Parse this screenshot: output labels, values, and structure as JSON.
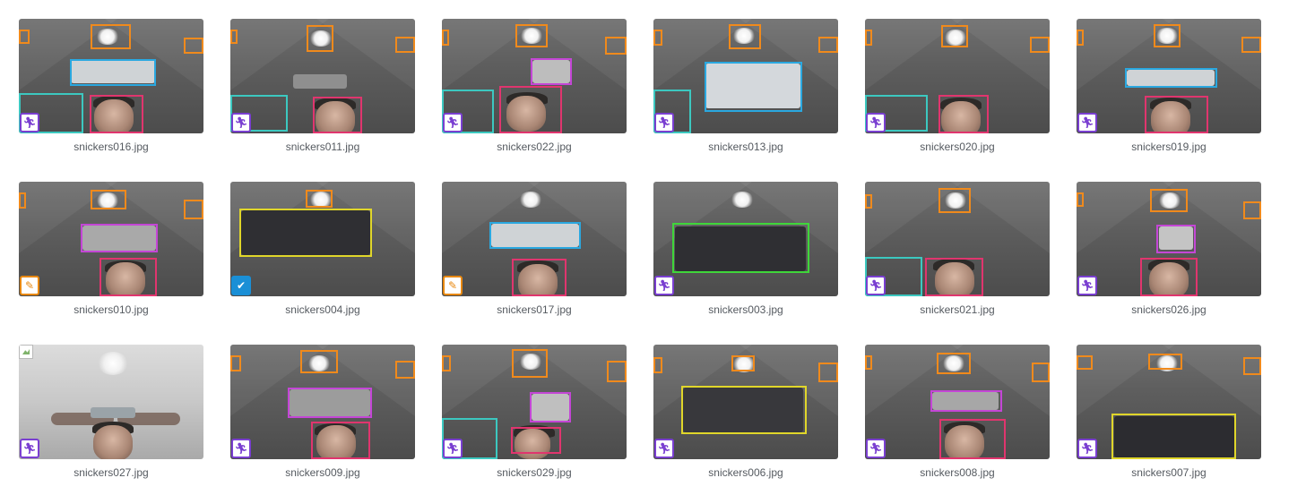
{
  "gallery": {
    "items": [
      {
        "filename": "snickers016.jpg",
        "badge_icon": "running-person-icon",
        "badge_color": "#7a3fd1"
      },
      {
        "filename": "snickers011.jpg",
        "badge_icon": "running-person-icon",
        "badge_color": "#7a3fd1"
      },
      {
        "filename": "snickers022.jpg",
        "badge_icon": "running-person-icon",
        "badge_color": "#7a3fd1"
      },
      {
        "filename": "snickers013.jpg",
        "badge_icon": "running-person-icon",
        "badge_color": "#7a3fd1"
      },
      {
        "filename": "snickers020.jpg",
        "badge_icon": "running-person-icon",
        "badge_color": "#7a3fd1"
      },
      {
        "filename": "snickers019.jpg",
        "badge_icon": "running-person-icon",
        "badge_color": "#7a3fd1"
      },
      {
        "filename": "snickers010.jpg",
        "badge_icon": "pencil-icon",
        "badge_color": "#e8880f"
      },
      {
        "filename": "snickers004.jpg",
        "badge_icon": "shield-check-icon",
        "badge_color": "#1a8fd6"
      },
      {
        "filename": "snickers017.jpg",
        "badge_icon": "pencil-icon",
        "badge_color": "#e8880f"
      },
      {
        "filename": "snickers003.jpg",
        "badge_icon": "running-person-icon",
        "badge_color": "#7a3fd1"
      },
      {
        "filename": "snickers021.jpg",
        "badge_icon": "running-person-icon",
        "badge_color": "#7a3fd1"
      },
      {
        "filename": "snickers026.jpg",
        "badge_icon": "running-person-icon",
        "badge_color": "#7a3fd1"
      },
      {
        "filename": "snickers027.jpg",
        "badge_icon": "running-person-icon",
        "badge_color": "#7a3fd1"
      },
      {
        "filename": "snickers009.jpg",
        "badge_icon": "running-person-icon",
        "badge_color": "#7a3fd1"
      },
      {
        "filename": "snickers029.jpg",
        "badge_icon": "running-person-icon",
        "badge_color": "#7a3fd1"
      },
      {
        "filename": "snickers006.jpg",
        "badge_icon": "running-person-icon",
        "badge_color": "#7a3fd1"
      },
      {
        "filename": "snickers008.jpg",
        "badge_icon": "running-person-icon",
        "badge_color": "#7a3fd1"
      },
      {
        "filename": "snickers007.jpg",
        "badge_icon": "running-person-icon",
        "badge_color": "#7a3fd1"
      }
    ]
  },
  "annotation_colors": {
    "light": "#f08a1c",
    "face": "#e0356e",
    "chips": "#2aa8e0",
    "arm": "#3cc8c0",
    "bag": "#c446d6",
    "wallet": "#e0d62a",
    "wallet_green": "#3fd63a"
  }
}
